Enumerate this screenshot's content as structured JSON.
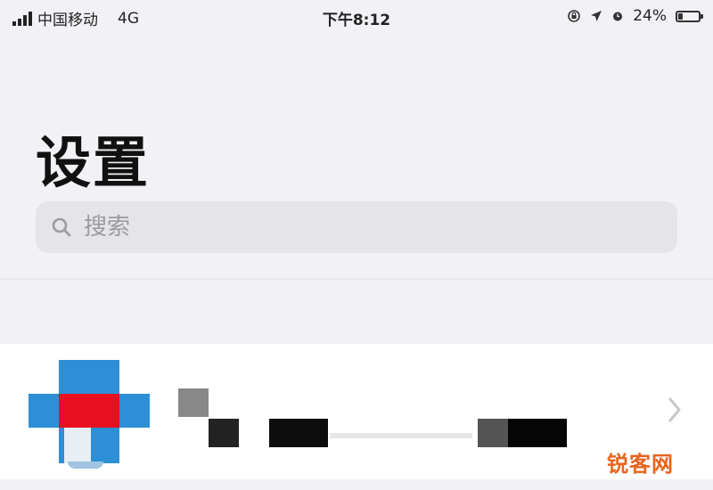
{
  "status_bar": {
    "carrier": "中国移动",
    "network": "4G",
    "time": "下午8:12",
    "battery": "24%",
    "battery_level": 0.24
  },
  "page": {
    "title": "设置"
  },
  "search": {
    "placeholder": "搜索"
  },
  "watermark": "锐客网",
  "colors": {
    "background": "#f2f2f6",
    "search_bg": "#e4e4e9",
    "avatar_blue": "#2d8fd6",
    "avatar_red": "#e8101f",
    "watermark": "#e8641e"
  }
}
